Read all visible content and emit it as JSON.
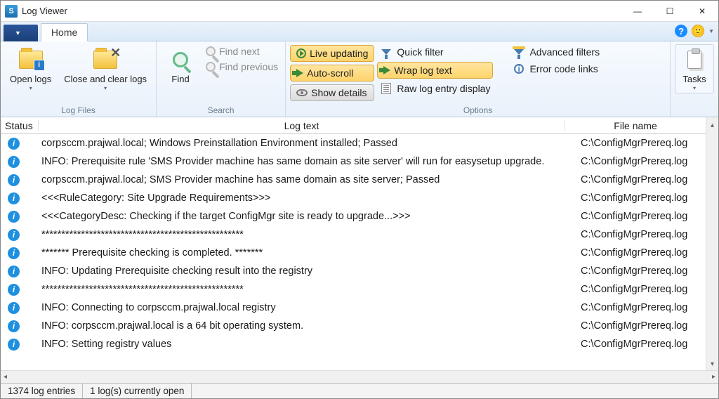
{
  "window": {
    "title": "Log Viewer"
  },
  "tabs": {
    "file_arrow": "▼",
    "home": "Home"
  },
  "ribbon": {
    "log_files": {
      "label": "Log Files",
      "open_logs": "Open logs",
      "close_clear": "Close and clear logs"
    },
    "search": {
      "label": "Search",
      "find": "Find",
      "find_next": "Find next",
      "find_previous": "Find previous"
    },
    "options": {
      "label": "Options",
      "live_updating": "Live updating",
      "auto_scroll": "Auto-scroll",
      "show_details": "Show details",
      "quick_filter": "Quick filter",
      "wrap_log_text": "Wrap log text",
      "raw_log": "Raw log entry display",
      "advanced_filters": "Advanced filters",
      "error_links": "Error code links"
    },
    "tasks": {
      "label": "Tasks"
    }
  },
  "columns": {
    "status": "Status",
    "text": "Log text",
    "file": "File name"
  },
  "rows": [
    {
      "text": "corpsccm.prajwal.local;    Windows Preinstallation Environment installed;    Passed",
      "file": "C:\\ConfigMgrPrereq.log"
    },
    {
      "text": "INFO: Prerequisite rule 'SMS Provider machine has same domain as site server' will run for easysetup upgrade.",
      "file": "C:\\ConfigMgrPrereq.log"
    },
    {
      "text": "corpsccm.prajwal.local;    SMS Provider machine has same domain as site server;    Passed",
      "file": "C:\\ConfigMgrPrereq.log"
    },
    {
      "text": "<<<RuleCategory: Site Upgrade Requirements>>>",
      "file": "C:\\ConfigMgrPrereq.log"
    },
    {
      "text": "<<<CategoryDesc: Checking if the target ConfigMgr site is ready to upgrade...>>>",
      "file": "C:\\ConfigMgrPrereq.log"
    },
    {
      "text": "***************************************************",
      "file": "C:\\ConfigMgrPrereq.log"
    },
    {
      "text": "******* Prerequisite checking is completed. *******",
      "file": "C:\\ConfigMgrPrereq.log"
    },
    {
      "text": "INFO: Updating Prerequisite checking result into the registry",
      "file": "C:\\ConfigMgrPrereq.log"
    },
    {
      "text": "***************************************************",
      "file": "C:\\ConfigMgrPrereq.log"
    },
    {
      "text": "INFO: Connecting to corpsccm.prajwal.local registry",
      "file": "C:\\ConfigMgrPrereq.log"
    },
    {
      "text": "INFO: corpsccm.prajwal.local is a 64 bit operating system.",
      "file": "C:\\ConfigMgrPrereq.log"
    },
    {
      "text": "INFO: Setting registry values",
      "file": "C:\\ConfigMgrPrereq.log"
    }
  ],
  "status": {
    "entries": "1374 log entries",
    "open": "1 log(s) currently open"
  }
}
